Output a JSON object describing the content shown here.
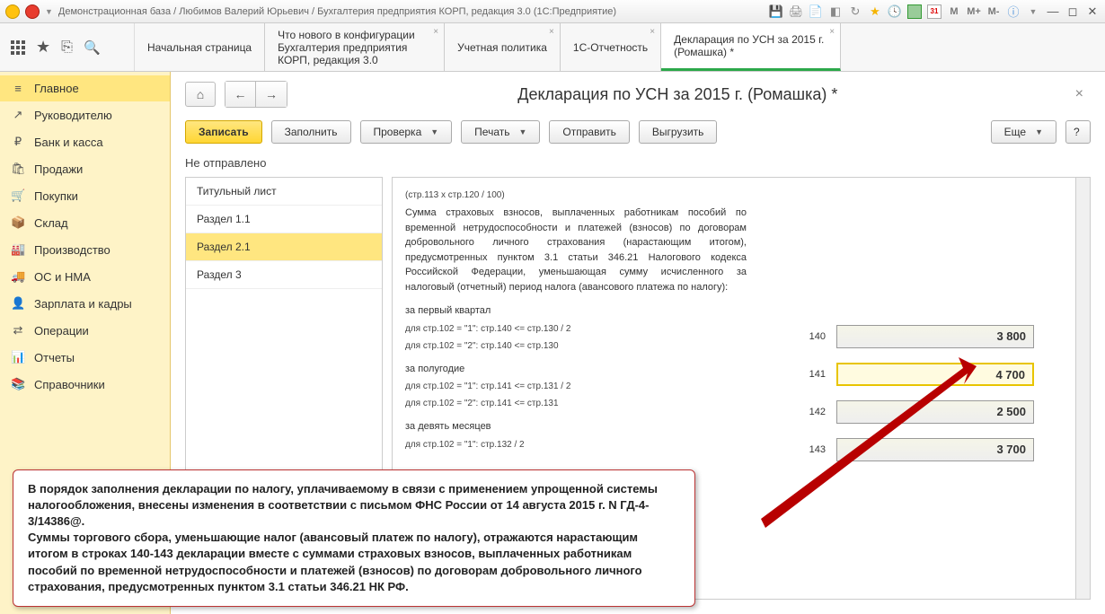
{
  "titlebar": {
    "title": "Демонстрационная база / Любимов Валерий Юрьевич / Бухгалтерия предприятия КОРП, редакция 3.0  (1С:Предприятие)",
    "m1": "M",
    "m2": "M+",
    "m3": "M-",
    "cal": "31"
  },
  "tabs": {
    "t0": "Начальная страница",
    "t1": "Что нового в конфигурации Бухгалтерия предприятия КОРП, редакция 3.0",
    "t2": "Учетная политика",
    "t3": "1С-Отчетность",
    "t4": "Декларация по УСН за 2015 г. (Ромашка) *"
  },
  "sidebar": [
    {
      "icon": "≡",
      "label": "Главное"
    },
    {
      "icon": "↗",
      "label": "Руководителю"
    },
    {
      "icon": "₽",
      "label": "Банк и касса"
    },
    {
      "icon": "🛍",
      "label": "Продажи"
    },
    {
      "icon": "🛒",
      "label": "Покупки"
    },
    {
      "icon": "📦",
      "label": "Склад"
    },
    {
      "icon": "🏭",
      "label": "Производство"
    },
    {
      "icon": "🚚",
      "label": "ОС и НМА"
    },
    {
      "icon": "👤",
      "label": "Зарплата и кадры"
    },
    {
      "icon": "⇄",
      "label": "Операции"
    },
    {
      "icon": "📊",
      "label": "Отчеты"
    },
    {
      "icon": "📚",
      "label": "Справочники"
    }
  ],
  "page": {
    "title": "Декларация по УСН за 2015 г. (Ромашка) *",
    "status": "Не отправлено",
    "btn_write": "Записать",
    "btn_fill": "Заполнить",
    "btn_check": "Проверка",
    "btn_print": "Печать",
    "btn_send": "Отправить",
    "btn_export": "Выгрузить",
    "btn_more": "Еще"
  },
  "sections": [
    "Титульный лист",
    "Раздел 1.1",
    "Раздел 2.1",
    "Раздел 3"
  ],
  "form": {
    "line0": "(стр.113 х стр.120 / 100)",
    "desc": "Сумма страховых взносов, выплаченных работникам пособий по временной нетрудоспособности и платежей (взносов) по договорам добровольного личного страхования (нарастающим итогом), предусмотренных пунктом 3.1 статьи 346.21 Налогового кодекса Российской Федерации, уменьшающая сумму исчисленного за налоговый (отчетный) период налога (авансового платежа по налогу):",
    "q1": "за первый квартал",
    "q1h1": "для стр.102 = \"1\": стр.140 <= стр.130 / 2",
    "q1h2": "для стр.102 = \"2\": стр.140 <= стр.130",
    "q2": "за полугодие",
    "q2h1": "для стр.102 = \"1\": стр.141 <= стр.131 / 2",
    "q2h2": "для стр.102 = \"2\": стр.141 <= стр.131",
    "q3": "за девять месяцев",
    "q3h1": "для стр.102 = \"1\": стр.132 / 2"
  },
  "fields": [
    {
      "code": "140",
      "val": "3 800"
    },
    {
      "code": "141",
      "val": "4 700"
    },
    {
      "code": "142",
      "val": "2 500"
    },
    {
      "code": "143",
      "val": "3 700"
    }
  ],
  "callout": "В порядок заполнения декларации по налогу, уплачиваемому в связи с применением упрощенной системы налогообложения, внесены изменения в соответствии с письмом ФНС России от 14 августа 2015 г. N ГД-4-3/14386@.\nСуммы торгового сбора, уменьшающие налог (авансовый платеж по налогу), отражаются нарастающим итогом в строках 140-143 декларации вместе с суммами страховых взносов, выплаченных работникам пособий по временной нетрудоспособности и платежей (взносов) по договорам добровольного личного страхования, предусмотренных пунктом 3.1 статьи 346.21 НК РФ."
}
